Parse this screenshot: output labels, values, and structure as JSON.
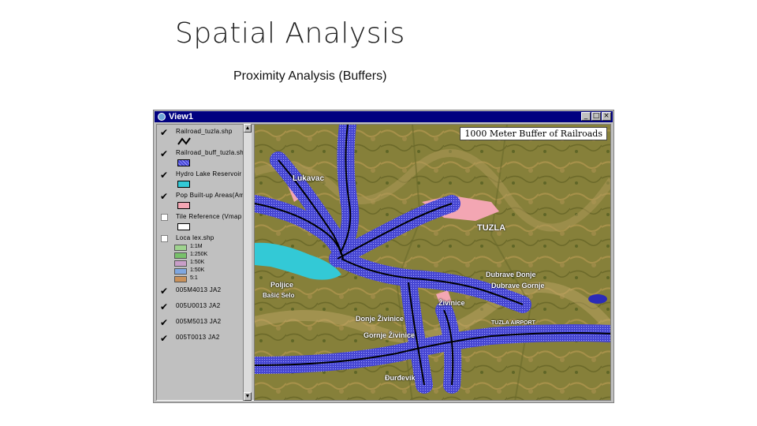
{
  "slide": {
    "title": "Spatial Analysis",
    "subtitle": "Proximity Analysis (Buffers)"
  },
  "window": {
    "title": "View1",
    "buttons": {
      "minimize": "_",
      "maximize": "□",
      "close": "×"
    }
  },
  "toc": {
    "layers": [
      {
        "name": "Railroad_tuzla.shp",
        "checked": true
      },
      {
        "name": "Railroad_buff_tuzla.sh",
        "checked": true
      },
      {
        "name": "Hydro Lake Reservoir",
        "checked": true
      },
      {
        "name": "Pop Built-up Areas(Am",
        "checked": true
      },
      {
        "name": "Tile Reference (Vmap",
        "checked": false
      },
      {
        "name": "Loca lex.shp",
        "checked": false
      },
      {
        "name": "005M4013 JA2",
        "checked": true
      },
      {
        "name": "005U0013 JA2",
        "checked": true
      },
      {
        "name": "005M5013 JA2",
        "checked": true
      },
      {
        "name": "005T0013 JA2",
        "checked": true
      }
    ],
    "legend": [
      {
        "label": "1:1M",
        "color": "#9fd38f"
      },
      {
        "label": "1:250K",
        "color": "#78c06a"
      },
      {
        "label": "1:50K",
        "color": "#c89ec8"
      },
      {
        "label": "1:50K",
        "color": "#7fa7e0"
      },
      {
        "label": "5:1",
        "color": "#c9915a"
      }
    ],
    "colors": {
      "railroad_line": "#000000",
      "buffer": "#4a4ad8",
      "lake": "#33c9d6",
      "built_up": "#f3a6b3"
    }
  },
  "map": {
    "label": "1000 Meter Buffer of Railroads",
    "places": [
      "Lukavac",
      "TUZLA",
      "Dubrave Donje",
      "Dubrave Gornje",
      "Poljice",
      "Bašić Selo",
      "Živinice",
      "Donje Živinice",
      "Gornje Živinice",
      "Đurđevik",
      "TUZLA AIRPORT"
    ]
  }
}
